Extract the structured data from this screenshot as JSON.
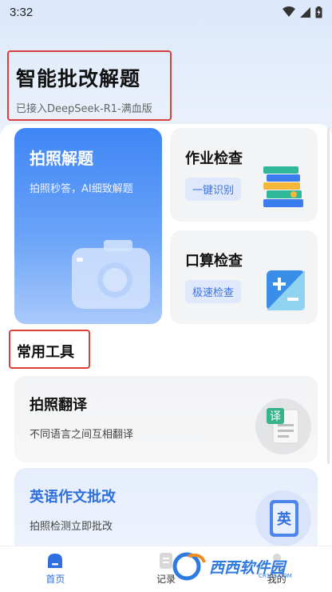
{
  "status_bar": {
    "time": "3:32"
  },
  "header": {
    "title": "智能批改解题",
    "subtitle": "已接入DeepSeek-R1-满血版"
  },
  "photo_card": {
    "title": "拍照解题",
    "subtitle": "拍照秒答，AI细致解题"
  },
  "homework_card": {
    "title": "作业检查",
    "chip": "一键识别"
  },
  "mental_math_card": {
    "title": "口算检查",
    "chip": "极速检查"
  },
  "section": {
    "title": "常用工具"
  },
  "tools": [
    {
      "title": "拍照翻译",
      "subtitle": "不同语言之间互相翻译",
      "icon_text": "译"
    },
    {
      "title": "英语作文批改",
      "subtitle": "拍照检测立即批改",
      "icon_text": "英"
    }
  ],
  "bottom_nav": [
    {
      "label": "首页",
      "active": true
    },
    {
      "label": "记录",
      "active": false
    },
    {
      "label": "我的",
      "active": false
    }
  ],
  "watermark": {
    "text": "西西软件园",
    "url": "CR173.COM"
  },
  "colors": {
    "accent": "#2f6fe0",
    "highlight_box": "#d9403a",
    "card_blue": "#3f86f6"
  }
}
